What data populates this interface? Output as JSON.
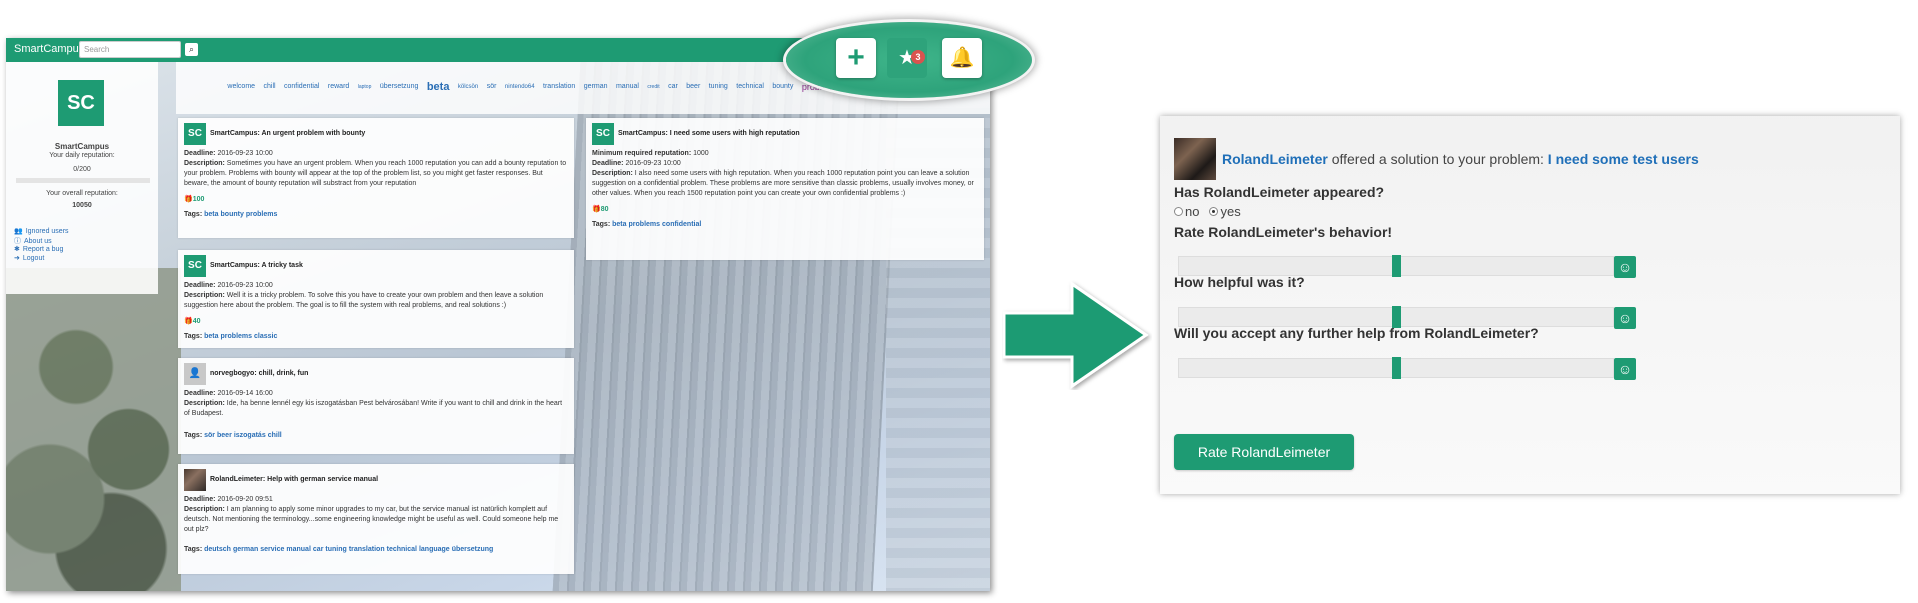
{
  "colors": {
    "brand": "#1e9b73",
    "link": "#2a6eb5",
    "badge": "#d9534f"
  },
  "left": {
    "brand": "SmartCampus",
    "search_placeholder": "Search",
    "sidebar": {
      "logo": "SC",
      "name": "SmartCampus",
      "daily_label": "Your daily reputation:",
      "daily_value": "0/200",
      "overall_label": "Your overall reputation:",
      "overall_value": "10050",
      "links": [
        "Ignored users",
        "About us",
        "Report a bug",
        "Logout"
      ],
      "link_icons": [
        "users-icon",
        "info-icon",
        "bug-icon",
        "logout-icon"
      ]
    },
    "tagcloud": [
      "welcome",
      "chill",
      "confidential",
      "reward",
      "laptop",
      "übersetzung",
      "beta",
      "kölcsön",
      "sör",
      "nintendo64",
      "translation",
      "german",
      "manual",
      "credit",
      "car",
      "beer",
      "tuning",
      "technical",
      "bounty",
      "problems",
      "classic",
      "language",
      "deutsch"
    ],
    "cards": [
      {
        "avatar": "SC",
        "title": "SmartCampus: An urgent problem with bounty",
        "deadline_label": "Deadline:",
        "deadline": "2016-09-23 10:00",
        "desc_label": "Description:",
        "desc": "Sometimes you have an urgent problem. When you reach 1000 reputation you can add a bounty reputation to your problem. Problems with bounty will appear at the top of the problem list, so you might get faster responses. But beware, the amount of bounty reputation will substract from your reputation",
        "bounty": "100",
        "tags_label": "Tags:",
        "tags": [
          "beta",
          "bounty",
          "problems"
        ]
      },
      {
        "avatar": "SC",
        "title": "SmartCampus: I need some users with high reputation",
        "req_label": "Minimum required reputation:",
        "req": "1000",
        "deadline_label": "Deadline:",
        "deadline": "2016-09-23 10:00",
        "desc_label": "Description:",
        "desc": "I also need some users with high reputation. When you reach 1000 reputation point you can leave a solution suggestion on a confidential problem. These problems are more sensitive than classic problems, usually involves money, or other values. When you reach 1500 reputation point you can create your own confidential problems :)",
        "bounty": "80",
        "tags_label": "Tags:",
        "tags": [
          "beta",
          "problems",
          "confidential"
        ]
      },
      {
        "avatar": "SC",
        "title": "SmartCampus: A tricky task",
        "deadline_label": "Deadline:",
        "deadline": "2016-09-23 10:00",
        "desc_label": "Description:",
        "desc": "Well it is a tricky problem. To solve this you have to create your own problem and then leave a solution suggestion here about the problem. The goal is to fill the system with real problems, and real solutions :)",
        "bounty": "40",
        "tags_label": "Tags:",
        "tags": [
          "beta",
          "problems",
          "classic"
        ]
      },
      {
        "title": "norvegbogyo: chill, drink, fun",
        "deadline_label": "Deadline:",
        "deadline": "2016-09-14 16:00",
        "desc_label": "Description:",
        "desc": "Ide, ha benne lennél egy kis iszogatásban Pest belvárosában! Write if you want to chill and drink in the heart of Budapest.",
        "tags_label": "Tags:",
        "tags": [
          "sör",
          "beer",
          "iszogatás",
          "chill"
        ]
      },
      {
        "title": "RolandLeimeter: Help with german service manual",
        "deadline_label": "Deadline:",
        "deadline": "2016-09-20 09:51",
        "desc_label": "Description:",
        "desc": "I am planning to apply some minor upgrades to my car, but the service manual ist natürlich komplett auf deutsch. Not mentioning the terminology...some engineering knowledge might be useful as well. Could someone help me out plz?",
        "tags_label": "Tags:",
        "tags": [
          "deutsch",
          "german",
          "service",
          "manual",
          "car",
          "tuning",
          "translation",
          "technical",
          "language",
          "übersetzung"
        ]
      }
    ],
    "floating": {
      "plus": "+",
      "star": "★",
      "badge": "3",
      "bell": "🔔"
    }
  },
  "right": {
    "user": "RolandLeimeter",
    "offered_text": " offered a solution to your problem: ",
    "problem": "I need some test users",
    "q_appeared": "Has RolandLeimeter appeared?",
    "opt_no": "no",
    "opt_yes": "yes",
    "selected": "yes",
    "q_behavior": "Rate RolandLeimeter's behavior!",
    "q_helpful": "How helpful was it?",
    "q_further": "Will you accept any further help from RolandLeimeter?",
    "slider_values": [
      0.5,
      0.5,
      0.5
    ],
    "smile": "☺",
    "button": "Rate RolandLeimeter"
  }
}
